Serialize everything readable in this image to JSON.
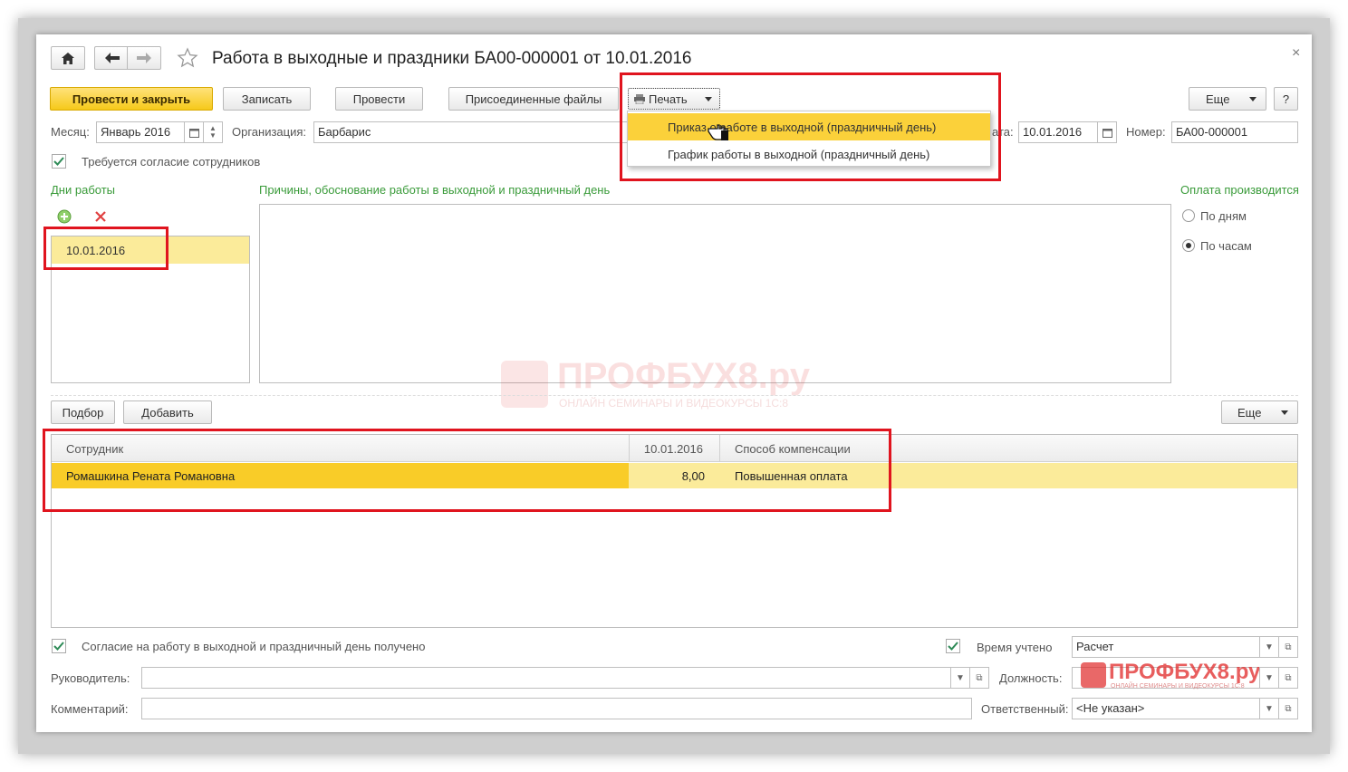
{
  "header": {
    "title": "Работа в выходные и праздники БА00-000001 от 10.01.2016",
    "close_glyph": "×"
  },
  "toolbar": {
    "post_close": "Провести и закрыть",
    "save": "Записать",
    "post": "Провести",
    "attached_files": "Присоединенные файлы",
    "print": "Печать",
    "more": "Еще",
    "help": "?"
  },
  "print_menu": {
    "items": [
      {
        "label": "Приказ о работе в выходной (праздничный день)",
        "highlighted": true
      },
      {
        "label": "График работы в выходной (праздничный день)",
        "highlighted": false
      }
    ]
  },
  "fields": {
    "month_label": "Месяц:",
    "month_value": "Январь 2016",
    "org_label": "Организация:",
    "org_value": "Барбарис",
    "date_label": "ата:",
    "date_value": "10.01.2016",
    "number_label": "Номер:",
    "number_value": "БА00-000001"
  },
  "consent_required": {
    "label": "Требуется согласие сотрудников",
    "checked": true
  },
  "work_days": {
    "title": "Дни работы",
    "items": [
      "10.01.2016"
    ]
  },
  "reasons": {
    "title": "Причины, обоснование работы в выходной и праздничный день",
    "value": ""
  },
  "payment": {
    "title": "Оплата производится",
    "options": [
      {
        "label": "По дням",
        "selected": false
      },
      {
        "label": "По часам",
        "selected": true
      }
    ]
  },
  "table_toolbar": {
    "select": "Подбор",
    "add": "Добавить",
    "more": "Еще"
  },
  "table": {
    "columns": [
      "Сотрудник",
      "10.01.2016",
      "Способ компенсации"
    ],
    "rows": [
      [
        "Ромашкина Рената Романовна",
        "8,00",
        "Повышенная оплата"
      ]
    ]
  },
  "bottom": {
    "consent_received": "Согласие на работу в выходной и праздничный день получено",
    "time_counted": "Время учтено",
    "time_counted_value": "Расчет",
    "manager_label": "Руководитель:",
    "manager_value": "",
    "position_label": "Должность:",
    "position_value": "",
    "comment_label": "Комментарий:",
    "comment_value": "",
    "responsible_label": "Ответственный:",
    "responsible_value": "<Не указан>"
  },
  "watermark": {
    "main": "ПРОФБУХ8.ру",
    "sub": "ОНЛАЙН СЕМИНАРЫ И ВИДЕОКУРСЫ 1С:8"
  },
  "colors": {
    "accent_yellow": "#fbd13a",
    "highlight_red": "#e0141e",
    "label_green": "#3a9b3a"
  }
}
